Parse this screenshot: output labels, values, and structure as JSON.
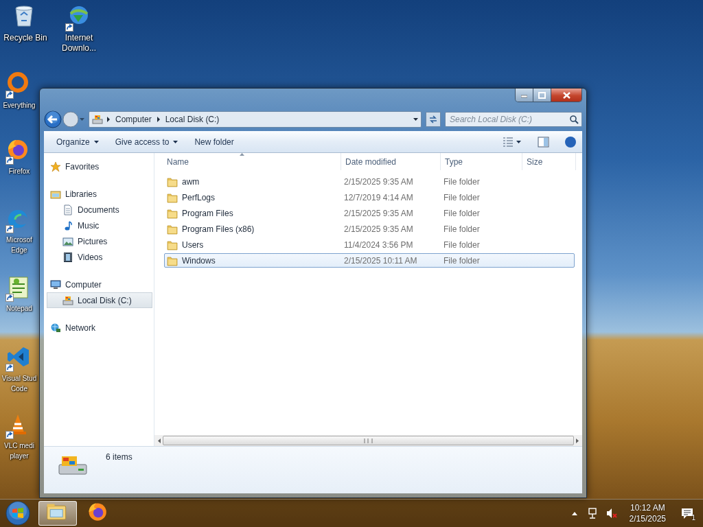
{
  "desktop_icons": [
    {
      "kind": "recycle",
      "shortcut": false,
      "label_lines": [
        "Recycle Bin"
      ]
    },
    {
      "kind": "download",
      "shortcut": true,
      "label_lines": [
        "Internet",
        "Downlo..."
      ]
    },
    {
      "kind": "ring",
      "shortcut": true,
      "label_lines": [
        "Everything"
      ]
    },
    {
      "kind": "firefox",
      "shortcut": true,
      "label_lines": [
        "Firefox"
      ]
    },
    {
      "kind": "edge",
      "shortcut": true,
      "label_lines": [
        "Microsof",
        "Edge"
      ]
    },
    {
      "kind": "notepad",
      "shortcut": true,
      "label_lines": [
        "Notepad"
      ]
    },
    {
      "kind": "code",
      "shortcut": true,
      "label_lines": [
        "Visual Stud",
        "Code"
      ]
    },
    {
      "kind": "cone",
      "shortcut": true,
      "label_lines": [
        "VLC medi",
        "player"
      ]
    }
  ],
  "window": {
    "address": {
      "crumbs": [
        "Computer",
        "Local Disk (C:)"
      ]
    },
    "search": {
      "placeholder": "Search Local Disk (C:)"
    },
    "toolbar": [
      {
        "label": "Organize",
        "menu": true
      },
      {
        "label": "Give access to",
        "menu": true
      },
      {
        "label": "New folder",
        "menu": false
      }
    ],
    "nav": [
      {
        "label": "Favorites",
        "kind": "star",
        "selected": false
      },
      {
        "label": "Libraries",
        "kind": "library",
        "selected": false,
        "children": [
          {
            "label": "Documents",
            "kind": "document",
            "selected": false
          },
          {
            "label": "Music",
            "kind": "music",
            "selected": false
          },
          {
            "label": "Pictures",
            "kind": "picture",
            "selected": false
          },
          {
            "label": "Videos",
            "kind": "video",
            "selected": false
          }
        ]
      },
      {
        "label": "Computer",
        "kind": "computer",
        "selected": false,
        "children": [
          {
            "label": "Local Disk (C:)",
            "kind": "drive",
            "selected": true
          }
        ]
      },
      {
        "label": "Network",
        "kind": "network",
        "selected": false
      }
    ],
    "columns": [
      "Name",
      "Date modified",
      "Type",
      "Size"
    ],
    "rows": [
      {
        "name": "awm",
        "date": "2/15/2025 9:35 AM",
        "type": "File folder",
        "selected": false
      },
      {
        "name": "PerfLogs",
        "date": "12/7/2019 4:14 AM",
        "type": "File folder",
        "selected": false
      },
      {
        "name": "Program Files",
        "date": "2/15/2025 9:35 AM",
        "type": "File folder",
        "selected": false
      },
      {
        "name": "Program Files (x86)",
        "date": "2/15/2025 9:35 AM",
        "type": "File folder",
        "selected": false
      },
      {
        "name": "Users",
        "date": "11/4/2024 3:56 PM",
        "type": "File folder",
        "selected": false
      },
      {
        "name": "Windows",
        "date": "2/15/2025 10:11 AM",
        "type": "File folder",
        "selected": true
      }
    ],
    "status": "6 items"
  },
  "taskbar": {
    "apps": [
      {
        "kind": "explorer",
        "active": true
      },
      {
        "kind": "firefox",
        "active": false
      }
    ],
    "clock_time": "10:12 AM",
    "clock_date": "2/15/2025",
    "notification_count": "1"
  }
}
